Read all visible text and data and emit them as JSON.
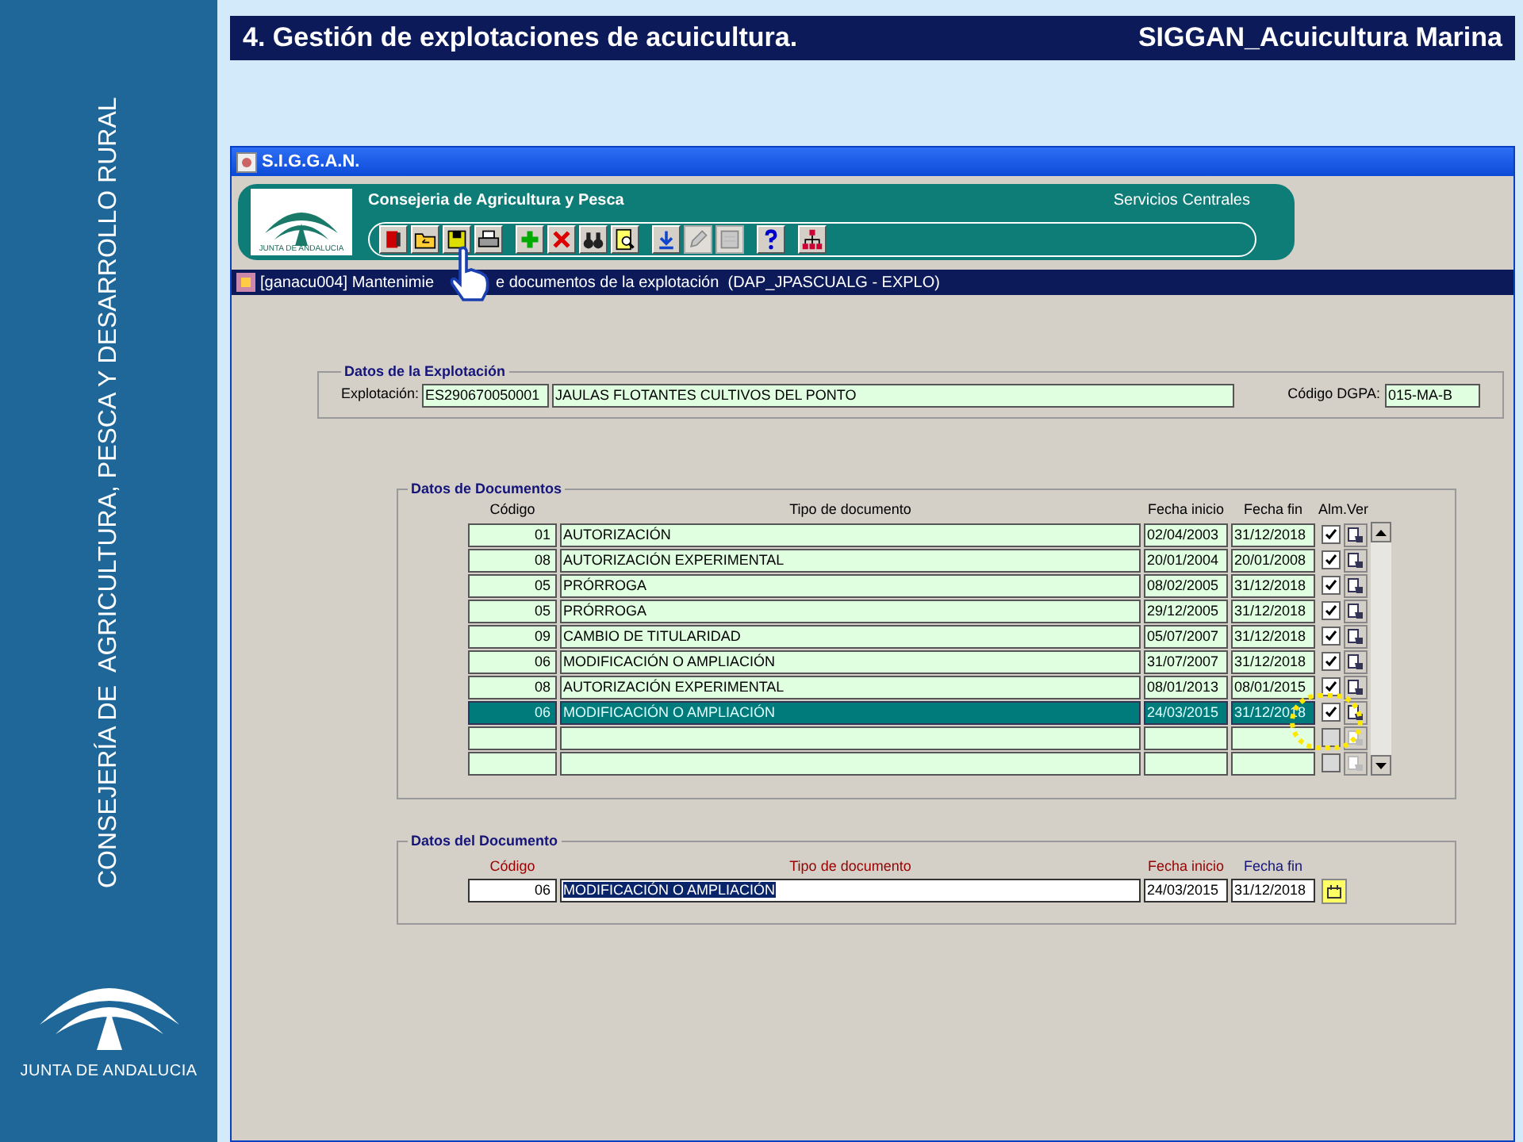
{
  "slide": {
    "title": "4. Gestión de explotaciones de acuicultura.",
    "subtitle": "SIGGAN_Acuicultura Marina",
    "sidebar_text": "CONSEJERÍA DE  AGRICULTURA, PESCA Y DESARROLLO RURAL",
    "logo_text": "JUNTA DE ANDALUCIA"
  },
  "window": {
    "title": "S.I.G.G.A.N.",
    "logo_text": "JUNTA DE ANDALUCIA",
    "org": "Consejeria de Agricultura y Pesca",
    "office": "Servicios Centrales",
    "toolbar": [
      [
        {
          "kind": "exit",
          "disabled": false
        },
        {
          "kind": "open",
          "disabled": false
        },
        {
          "kind": "save",
          "disabled": false
        },
        {
          "kind": "print",
          "disabled": false
        }
      ],
      [
        {
          "kind": "add",
          "disabled": false
        },
        {
          "kind": "delete",
          "disabled": false
        },
        {
          "kind": "find",
          "disabled": false
        },
        {
          "kind": "preview",
          "disabled": false
        }
      ],
      [
        {
          "kind": "download",
          "disabled": false
        },
        {
          "kind": "edit",
          "disabled": true
        },
        {
          "kind": "form",
          "disabled": true
        }
      ],
      [
        {
          "kind": "help",
          "disabled": false
        }
      ],
      [
        {
          "kind": "tree",
          "disabled": false
        }
      ]
    ],
    "form_title": [
      "[ganacu004] Mantenimie",
      "e documentos de la explotación  (DAP_JPASCUALG - EXPLO)"
    ]
  },
  "explotacion": {
    "legend": "Datos de la Explotación",
    "label": "Explotación:",
    "code": "ES290670050001",
    "name": "JAULAS FLOTANTES CULTIVOS DEL PONTO",
    "dgpa_label": "Código DGPA:",
    "dgpa": "015-MA-B"
  },
  "documentos": {
    "legend": "Datos de Documentos",
    "columns": [
      "Código",
      "Tipo de documento",
      "Fecha inicio",
      "Fecha fin",
      "Alm.Ver"
    ],
    "rows": [
      {
        "codigo": "01",
        "tipo": "AUTORIZACIÓN",
        "inicio": "02/04/2003",
        "fin": "31/12/2018",
        "alm": true,
        "selected": false
      },
      {
        "codigo": "08",
        "tipo": "AUTORIZACIÓN EXPERIMENTAL",
        "inicio": "20/01/2004",
        "fin": "20/01/2008",
        "alm": true,
        "selected": false
      },
      {
        "codigo": "05",
        "tipo": "PRÓRROGA",
        "inicio": "08/02/2005",
        "fin": "31/12/2018",
        "alm": true,
        "selected": false
      },
      {
        "codigo": "05",
        "tipo": "PRÓRROGA",
        "inicio": "29/12/2005",
        "fin": "31/12/2018",
        "alm": true,
        "selected": false
      },
      {
        "codigo": "09",
        "tipo": "CAMBIO DE TITULARIDAD",
        "inicio": "05/07/2007",
        "fin": "31/12/2018",
        "alm": true,
        "selected": false
      },
      {
        "codigo": "06",
        "tipo": "MODIFICACIÓN O AMPLIACIÓN",
        "inicio": "31/07/2007",
        "fin": "31/12/2018",
        "alm": true,
        "selected": false
      },
      {
        "codigo": "08",
        "tipo": "AUTORIZACIÓN EXPERIMENTAL",
        "inicio": "08/01/2013",
        "fin": "08/01/2015",
        "alm": true,
        "selected": false
      },
      {
        "codigo": "06",
        "tipo": "MODIFICACIÓN O AMPLIACIÓN",
        "inicio": "24/03/2015",
        "fin": "31/12/2018",
        "alm": true,
        "selected": true
      },
      {
        "alm": false,
        "selected": false
      },
      {
        "alm": false,
        "selected": false
      }
    ]
  },
  "documento": {
    "legend": "Datos del Documento",
    "fields": [
      {
        "label": "Código",
        "value": "06",
        "required": true,
        "text_selected": false
      },
      {
        "label": "Tipo de documento",
        "value": "MODIFICACIÓN O AMPLIACIÓN",
        "required": true,
        "text_selected": true
      },
      {
        "label": "Fecha inicio",
        "value": "24/03/2015",
        "required": true,
        "text_selected": false
      },
      {
        "label": "Fecha fin",
        "value": "31/12/2018",
        "required": false,
        "text_selected": false
      }
    ]
  }
}
